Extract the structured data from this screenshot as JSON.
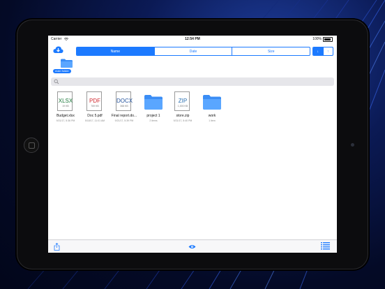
{
  "status": {
    "carrier": "Carrier",
    "time": "12:54 PM",
    "battery": "100%"
  },
  "toolbar": {
    "sort_tabs": [
      "Name",
      "Date",
      "Size"
    ],
    "active_tab": 0,
    "sort_down": "↓",
    "sort_up": "↑"
  },
  "breadcrumb": {
    "label": "main folder"
  },
  "search": {
    "placeholder": "",
    "value": ""
  },
  "items": [
    {
      "type": "file",
      "ext": "XLSX",
      "size": "19 KB",
      "name": "Budget.xlsx",
      "sub": "9/21/17, 5:36 PM",
      "color": "#1f7a3d"
    },
    {
      "type": "file",
      "ext": "PDF",
      "size": "769 KB",
      "name": "Doc 5.pdf",
      "sub": "5/18/17, 11:01 AM",
      "color": "#d0282e"
    },
    {
      "type": "file",
      "ext": "DOCX",
      "size": "368 KB",
      "name": "Final report.do...",
      "sub": "9/21/17, 5:39 PM",
      "color": "#1f4f9a"
    },
    {
      "type": "folder",
      "name": "project 1",
      "sub": "2 items"
    },
    {
      "type": "file",
      "ext": "ZIP",
      "size": "1,000 KB",
      "name": "store.zip",
      "sub": "9/21/17, 5:40 PM",
      "color": "#2a6fb0"
    },
    {
      "type": "folder",
      "name": "work",
      "sub": "1 item"
    }
  ],
  "colors": {
    "accent": "#1c7aff",
    "folder": "#3a8df5"
  },
  "icons": [
    "cloud-download-icon",
    "search-icon",
    "folder-icon",
    "share-icon",
    "eye-icon",
    "list-icon"
  ]
}
